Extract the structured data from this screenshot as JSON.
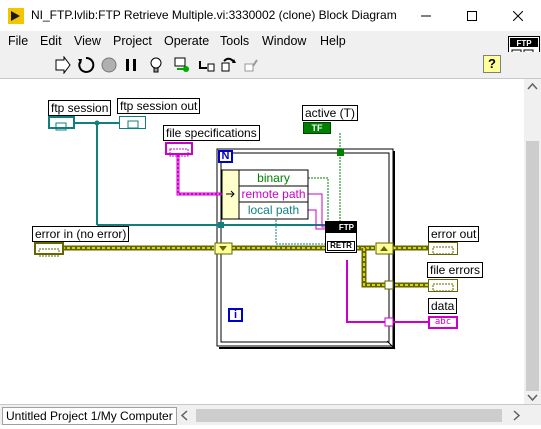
{
  "window": {
    "title": "NI_FTP.lvlib:FTP Retrieve Multiple.vi:3330002 (clone) Block Diagram"
  },
  "menu": {
    "items": [
      "File",
      "Edit",
      "View",
      "Project",
      "Operate",
      "Tools",
      "Window",
      "Help"
    ]
  },
  "toolbar": {
    "help": "?"
  },
  "diagram": {
    "labels": {
      "ftp_session": "ftp session",
      "ftp_session_out": "ftp session out",
      "file_specifications": "file specifications",
      "active": "active (T)",
      "error_in": "error in (no error)",
      "error_out": "error out",
      "file_errors": "file errors",
      "data": "data"
    },
    "unbundle": {
      "fields": [
        "binary",
        "remote path",
        "local path"
      ]
    },
    "loop": {
      "count_terminal": "N",
      "iteration_terminal": "i"
    },
    "ftp_node": {
      "top": "FTP",
      "bottom": "RETR"
    },
    "constants": {
      "active_value": "TF",
      "data_type": "abc"
    }
  },
  "status": {
    "project": "Untitled Project 1/My Computer"
  }
}
